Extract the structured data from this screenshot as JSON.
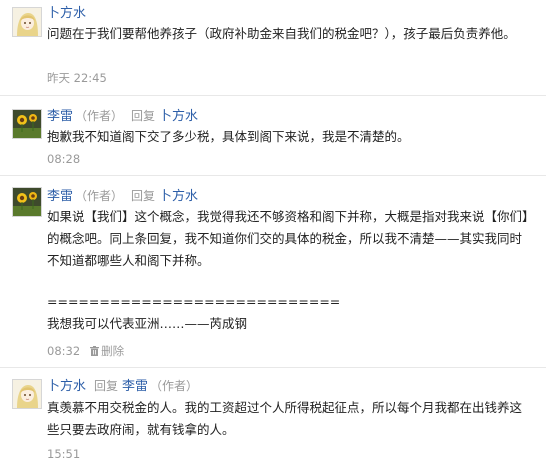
{
  "comments": [
    {
      "author": "卜方水",
      "author_tag": "",
      "reply_label": "",
      "reply_to": "",
      "reply_to_tag": "",
      "body": [
        "问题在于我们要帮他养孩子（政府补助金来自我们的税金吧？），孩子最后负责养他。"
      ],
      "time": "昨天 22:45",
      "delete_label": ""
    },
    {
      "author": "李雷",
      "author_tag": "（作者）",
      "reply_label": "回复",
      "reply_to": "卜方水",
      "reply_to_tag": "",
      "body": [
        "抱歉我不知道阁下交了多少税，具体到阁下来说，我是不清楚的。"
      ],
      "time": "08:28",
      "delete_label": ""
    },
    {
      "author": "李雷",
      "author_tag": "（作者）",
      "reply_label": "回复",
      "reply_to": "卜方水",
      "reply_to_tag": "",
      "body": [
        "如果说【我们】这个概念，我觉得我还不够资格和阁下并称，大概是指对我来说【你们】的概念吧。同上条回复，我不知道你们交的具体的税金，所以我不清楚——其实我同时不知道都哪些人和阁下并称。",
        "============================",
        "我想我可以代表亚洲……——芮成钢"
      ],
      "time": "08:32",
      "delete_label": "删除"
    },
    {
      "author": "卜方水",
      "author_tag": "",
      "reply_label": "回复",
      "reply_to": "李雷",
      "reply_to_tag": "（作者）",
      "body": [
        "真羡慕不用交税金的人。我的工资超过个人所得税起征点，所以每个月我都在出钱养这些只要去政府闹，就有钱拿的人。"
      ],
      "time": "15:51",
      "delete_label": ""
    }
  ],
  "icons": {
    "avatar_a": "anime-girl-avatar",
    "avatar_b": "sunflower-avatar",
    "delete": "trash-icon"
  },
  "colors": {
    "link": "#2c5ea8",
    "muted": "#9a9a9a",
    "text": "#222222",
    "divider": "#e8e8e8"
  }
}
